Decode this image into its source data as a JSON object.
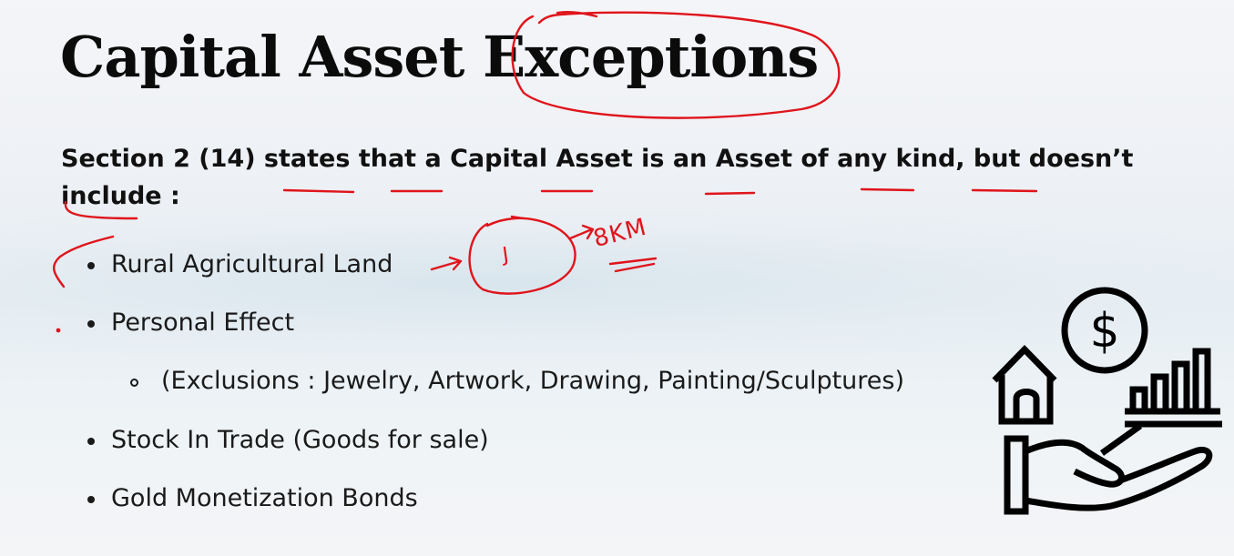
{
  "slide": {
    "title": "Capital Asset Exceptions",
    "intro": "Section 2 (14) states that a Capital Asset is an Asset of any kind, but doesn’t include :",
    "bullets": [
      "Rural Agricultural Land",
      "Personal Effect",
      "(Exclusions : Jewelry, Artwork, Drawing, Painting/Sculptures)",
      "Stock In Trade (Goods for sale)",
      "Gold Monetization Bonds"
    ],
    "annotations": {
      "circle_letter": "J",
      "distance_note": "8KM",
      "ink_color": "#e0141b"
    },
    "illustration": {
      "icon": "hand-holding-house-dollar-growth-icon",
      "currency_symbol": "$"
    }
  }
}
